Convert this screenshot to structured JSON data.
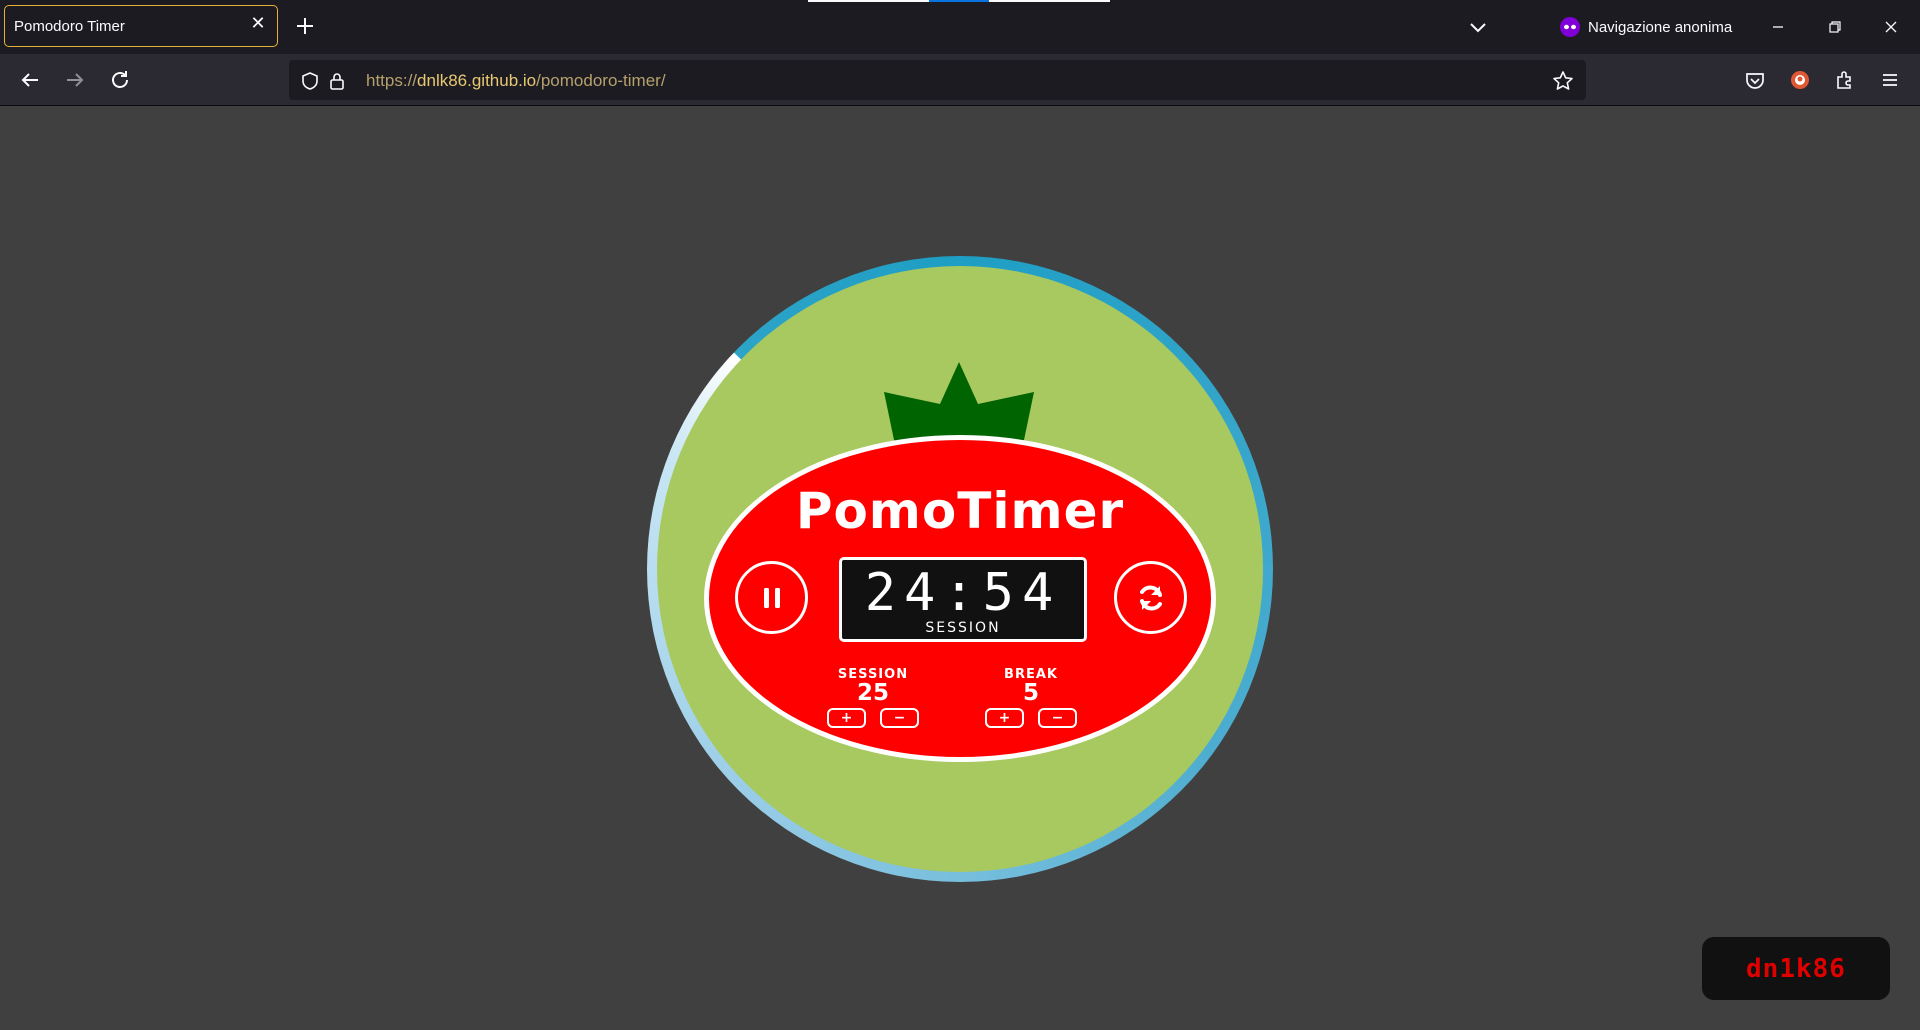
{
  "browser": {
    "tab": {
      "title": "Pomodoro Timer",
      "close_icon": "close-icon"
    },
    "new_tab_icon": "plus-icon",
    "tab_list_icon": "chevron-down-icon",
    "private_mode_label": "Navigazione anonima",
    "window_controls": [
      "minimize-icon",
      "restore-icon",
      "close-icon"
    ],
    "nav": {
      "back": "back-arrow-icon",
      "forward": "forward-arrow-icon",
      "reload": "reload-icon"
    },
    "url": {
      "scheme": "https://",
      "host": "dnlk86.github.io",
      "path": "/pomodoro-timer/"
    },
    "toolbar_icons": [
      "pocket-icon",
      "duckduckgo-icon",
      "extensions-icon",
      "menu-icon"
    ]
  },
  "app": {
    "title": "PomoTimer",
    "timer": {
      "time": "24:54",
      "mode": "SESSION"
    },
    "progress_fraction_elapsed": 0.13,
    "session": {
      "label": "SESSION",
      "value": "25",
      "plus": "+",
      "minus": "−"
    },
    "break": {
      "label": "BREAK",
      "value": "5",
      "plus": "+",
      "minus": "−"
    },
    "signature": "dn1k86"
  },
  "colors": {
    "page_bg": "#404040",
    "disc": "#a8c960",
    "tomato": "#ff0000",
    "leaves": "#006400",
    "ring_accent": "#1e9ec4",
    "signature_text": "#e00000",
    "url_host": "#e8c872"
  }
}
